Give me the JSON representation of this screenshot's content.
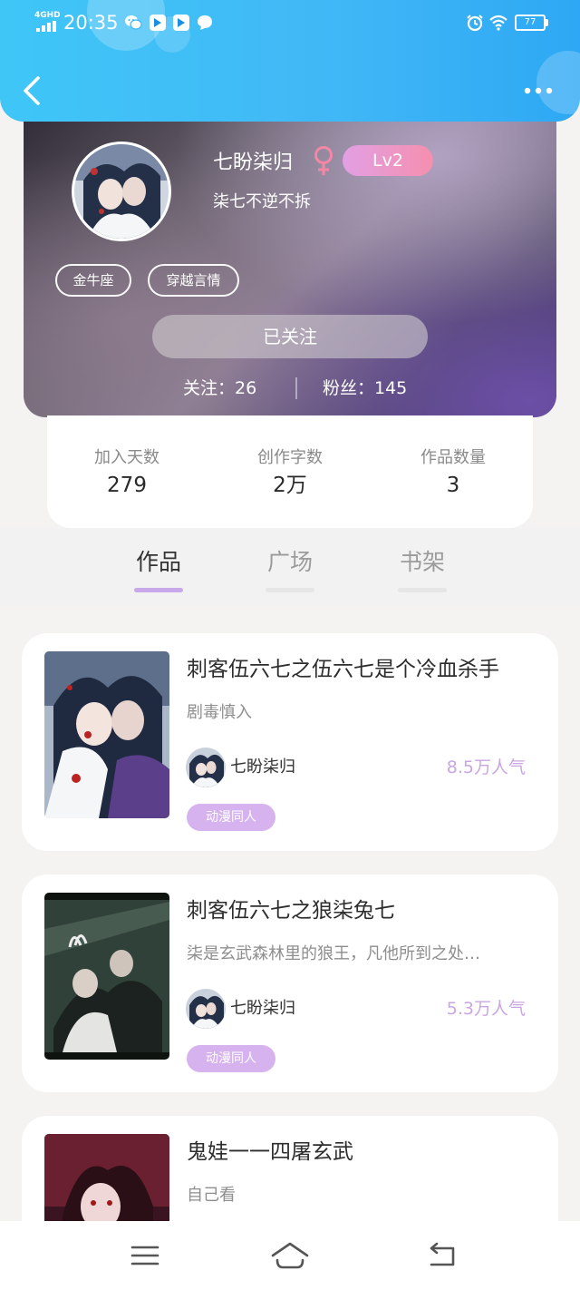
{
  "status_bar": {
    "network": "4GHD",
    "time": "20:35",
    "battery": "77"
  },
  "header": {
    "back_icon": "chevron-left-icon",
    "more_icon": "more-dots-icon"
  },
  "profile": {
    "name": "七盼柒归",
    "gender_icon": "female-icon",
    "level": "Lv2",
    "signature": "柒七不逆不拆",
    "tags": [
      "金牛座",
      "穿越言情"
    ],
    "follow_button": "已关注",
    "following_label": "关注：26",
    "followers_label": "粉丝：145"
  },
  "stats": [
    {
      "label": "加入天数",
      "value": "279"
    },
    {
      "label": "创作字数",
      "value": "2万"
    },
    {
      "label": "作品数量",
      "value": "3"
    }
  ],
  "tabs": [
    {
      "label": "作品",
      "active": true
    },
    {
      "label": "广场",
      "active": false
    },
    {
      "label": "书架",
      "active": false
    }
  ],
  "works": [
    {
      "title": "刺客伍六七之伍六七是个冷血杀手",
      "desc": "剧毒慎入",
      "author": "七盼柒归",
      "popularity": "8.5万人气",
      "tag": "动漫同人"
    },
    {
      "title": "刺客伍六七之狼柒兔七",
      "desc": "柒是玄武森林里的狼王，凡他所到之处…",
      "author": "七盼柒归",
      "popularity": "5.3万人气",
      "tag": "动漫同人"
    },
    {
      "title": "鬼娃一一四屠玄武",
      "desc": "自己看",
      "author": "",
      "popularity": "",
      "tag": ""
    }
  ],
  "nav": {
    "menu_icon": "menu-icon",
    "home_icon": "home-icon",
    "back_icon": "back-icon"
  },
  "colors": {
    "header": "#41b8f6",
    "accent_purple": "#d6b3ef",
    "popularity": "#c9a6e2",
    "level_badge": "#f58fae"
  }
}
